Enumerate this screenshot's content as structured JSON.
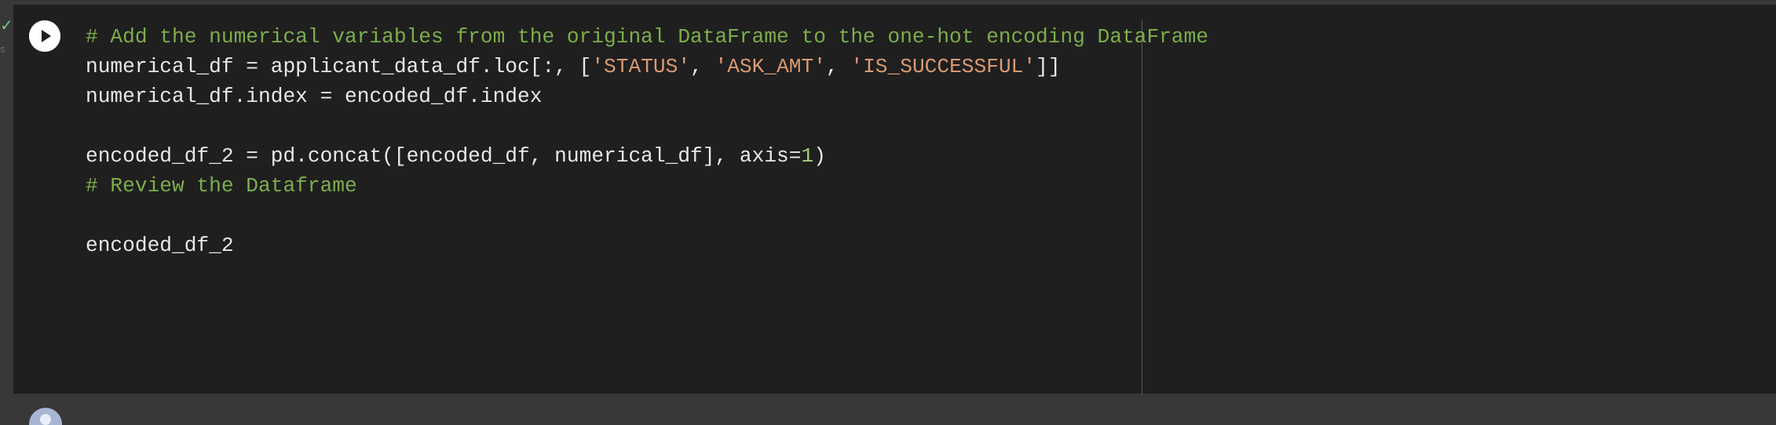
{
  "execution": {
    "status_icon": "check-icon",
    "time_text": "s"
  },
  "cell": {
    "run_button_icon": "play-icon",
    "code_lines": [
      {
        "tokens": [
          {
            "type": "comment",
            "text": "# Add the numerical variables from the original DataFrame to the one-hot encoding DataFrame"
          }
        ]
      },
      {
        "tokens": [
          {
            "type": "text",
            "text": "numerical_df = applicant_data_df.loc[:, ["
          },
          {
            "type": "string",
            "text": "'STATUS'"
          },
          {
            "type": "text",
            "text": ", "
          },
          {
            "type": "string",
            "text": "'ASK_AMT'"
          },
          {
            "type": "text",
            "text": ", "
          },
          {
            "type": "string",
            "text": "'IS_SUCCESSFUL'"
          },
          {
            "type": "text",
            "text": "]]"
          }
        ]
      },
      {
        "tokens": [
          {
            "type": "text",
            "text": "numerical_df.index = encoded_df.index"
          }
        ]
      },
      {
        "tokens": []
      },
      {
        "tokens": [
          {
            "type": "text",
            "text": "encoded_df_2 = pd.concat([encoded_df, numerical_df], axis="
          },
          {
            "type": "number",
            "text": "1"
          },
          {
            "type": "text",
            "text": ")"
          }
        ]
      },
      {
        "tokens": [
          {
            "type": "comment",
            "text": "# Review the Dataframe"
          }
        ]
      },
      {
        "tokens": []
      },
      {
        "tokens": [
          {
            "type": "text",
            "text": "encoded_df_2"
          }
        ]
      }
    ]
  },
  "next_cell": {
    "avatar_icon": "user-avatar-icon"
  },
  "colors": {
    "page_background": "#383838",
    "cell_background": "#1f1f1f",
    "comment": "#7cae4b",
    "string": "#d99a72",
    "number": "#a7cf7e",
    "text": "#e8e8e8",
    "status_ok": "#7bc47f"
  }
}
